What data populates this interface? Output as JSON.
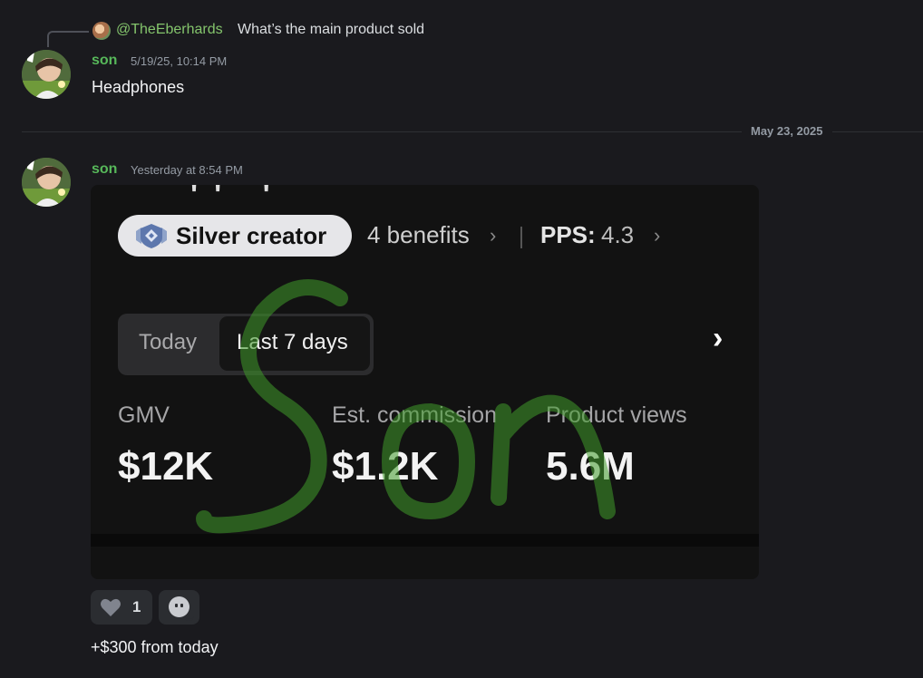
{
  "reply": {
    "username": "@TheEberhards",
    "text": "What’s the main product sold"
  },
  "messages": [
    {
      "username": "son",
      "timestamp": "5/19/25, 10:14 PM",
      "text": "Headphones"
    },
    {
      "username": "son",
      "timestamp": "Yesterday at 8:54 PM",
      "followup_text": "+$300 from today"
    }
  ],
  "divider": {
    "label": "May 23, 2025"
  },
  "embed": {
    "creator_badge": "Silver creator",
    "benefits": "4 benefits",
    "pps_label": "PPS:",
    "pps_value": "4.3",
    "tabs": [
      "Today",
      "Last 7 days"
    ],
    "metrics": [
      {
        "label": "GMV",
        "value": "$12K"
      },
      {
        "label": "Est. commission",
        "value": "$1.2K"
      },
      {
        "label": "Product views",
        "value": "5.6M"
      }
    ],
    "watermark_color": "#3f9a2a"
  },
  "reactions": [
    {
      "icon": "heart-icon",
      "count": "1"
    }
  ],
  "colors": {
    "background": "#1a1a1e",
    "username": "#57b85a",
    "reply_username": "#84c46c"
  }
}
